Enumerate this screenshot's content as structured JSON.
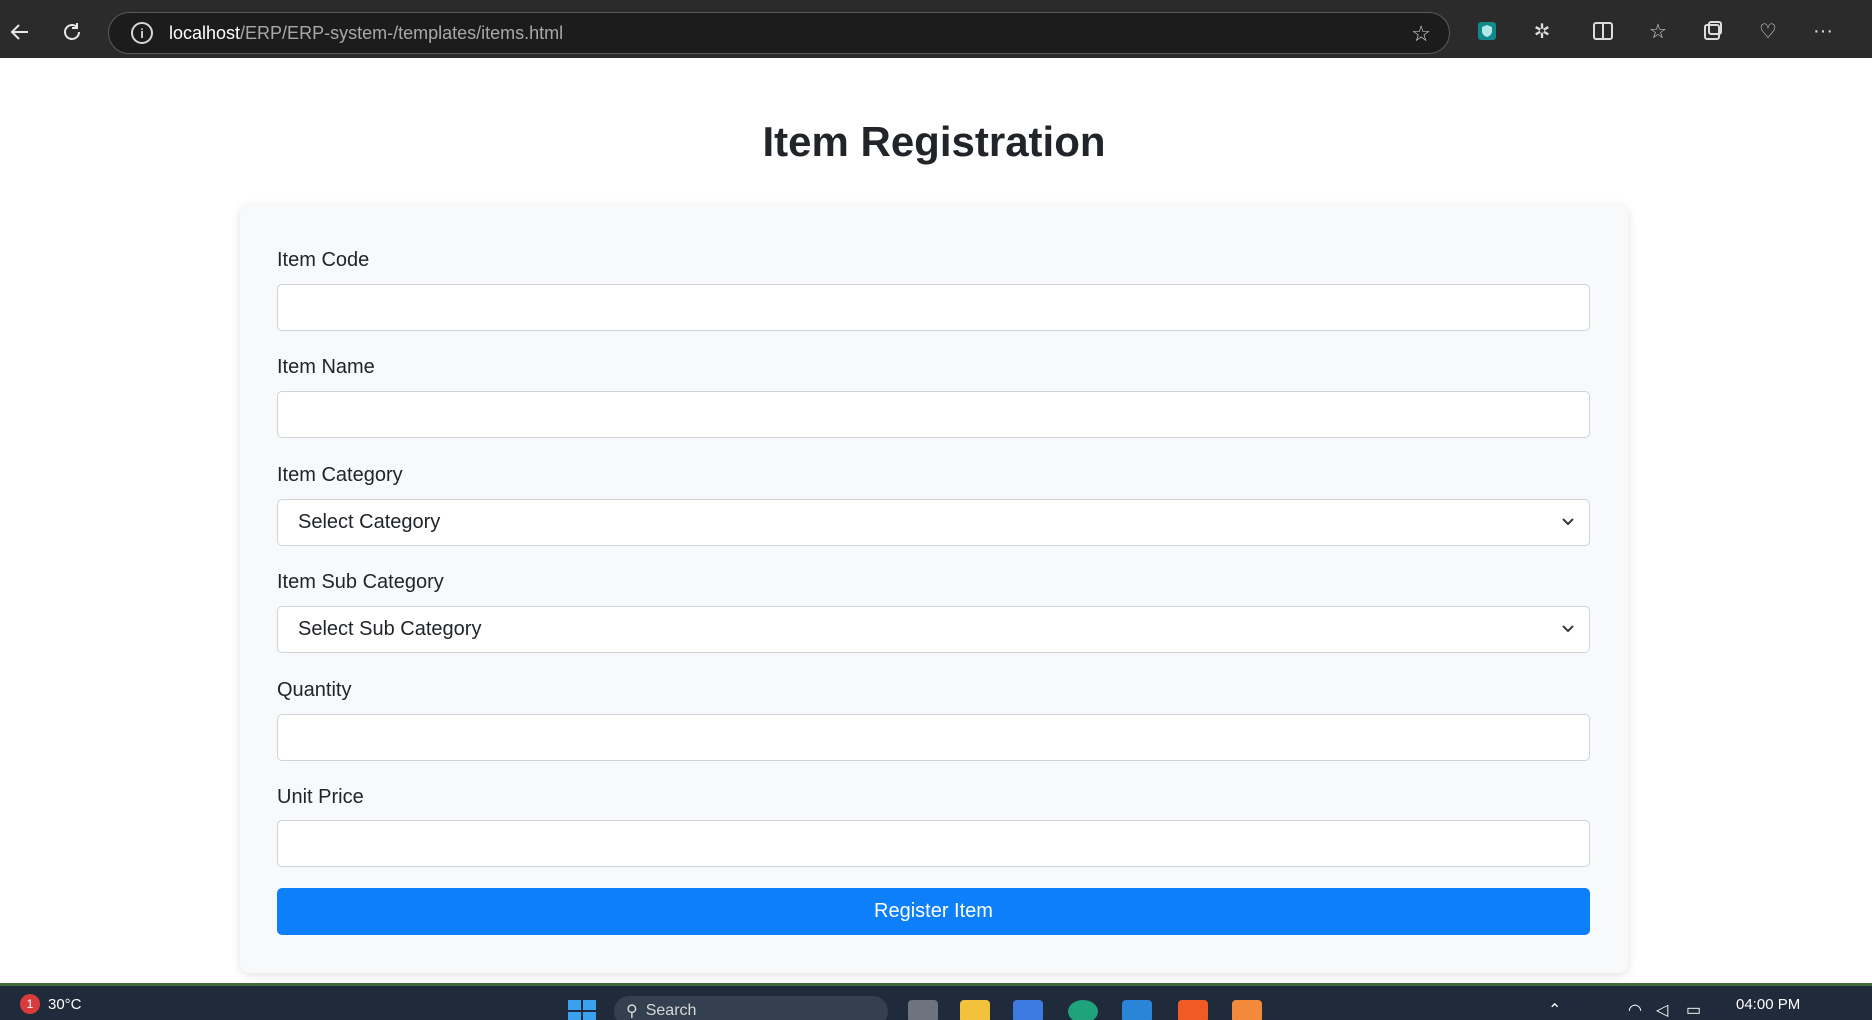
{
  "browser": {
    "url_host": "localhost",
    "url_path": "/ERP/ERP-system-/templates/items.html",
    "toolbar_icons": [
      "back-icon",
      "reload-icon",
      "info-icon",
      "favorite-star-icon",
      "extension-shield-icon",
      "extensions-icon",
      "split-screen-icon",
      "favorites-icon",
      "collections-icon",
      "browser-essentials-icon",
      "more-options-icon"
    ]
  },
  "page": {
    "title": "Item Registration"
  },
  "form": {
    "item_code": {
      "label": "Item Code",
      "value": "",
      "placeholder": ""
    },
    "item_name": {
      "label": "Item Name",
      "value": "",
      "placeholder": ""
    },
    "item_category": {
      "label": "Item Category",
      "selected": "Select Category"
    },
    "item_sub_category": {
      "label": "Item Sub Category",
      "selected": "Select Sub Category"
    },
    "quantity": {
      "label": "Quantity",
      "value": "",
      "placeholder": ""
    },
    "unit_price": {
      "label": "Unit Price",
      "value": "",
      "placeholder": ""
    },
    "submit_label": "Register Item"
  },
  "taskbar": {
    "weather_temp": "30°C",
    "weather_badge": "1",
    "search_label": "Search",
    "clock_time": "04:00 PM"
  },
  "colors": {
    "primary_button": "#0d7ffb",
    "card_background": "#f8f9fa",
    "browser_chrome": "#2b2b2b",
    "taskbar": "#1f2a3a"
  }
}
